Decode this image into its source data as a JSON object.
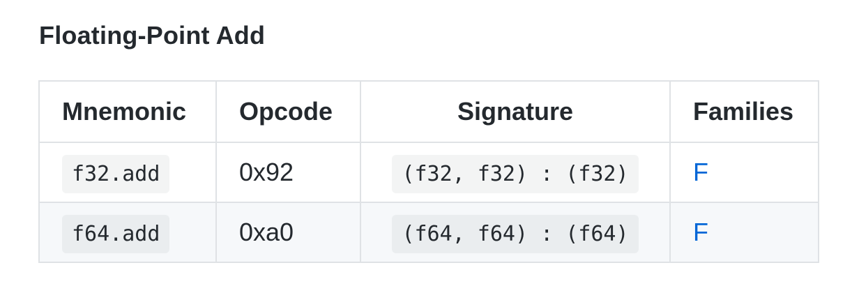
{
  "heading": "Floating-Point Add",
  "table": {
    "headers": {
      "mnemonic": "Mnemonic",
      "opcode": "Opcode",
      "signature": "Signature",
      "families": "Families"
    },
    "rows": [
      {
        "mnemonic": "f32.add",
        "opcode": "0x92",
        "signature": "(f32, f32) : (f32)",
        "families": "F"
      },
      {
        "mnemonic": "f64.add",
        "opcode": "0xa0",
        "signature": "(f64, f64) : (f64)",
        "families": "F"
      }
    ]
  },
  "colors": {
    "text": "#24292e",
    "border": "#dfe2e5",
    "alt_row": "#f6f8fa",
    "link": "#0366d6"
  }
}
